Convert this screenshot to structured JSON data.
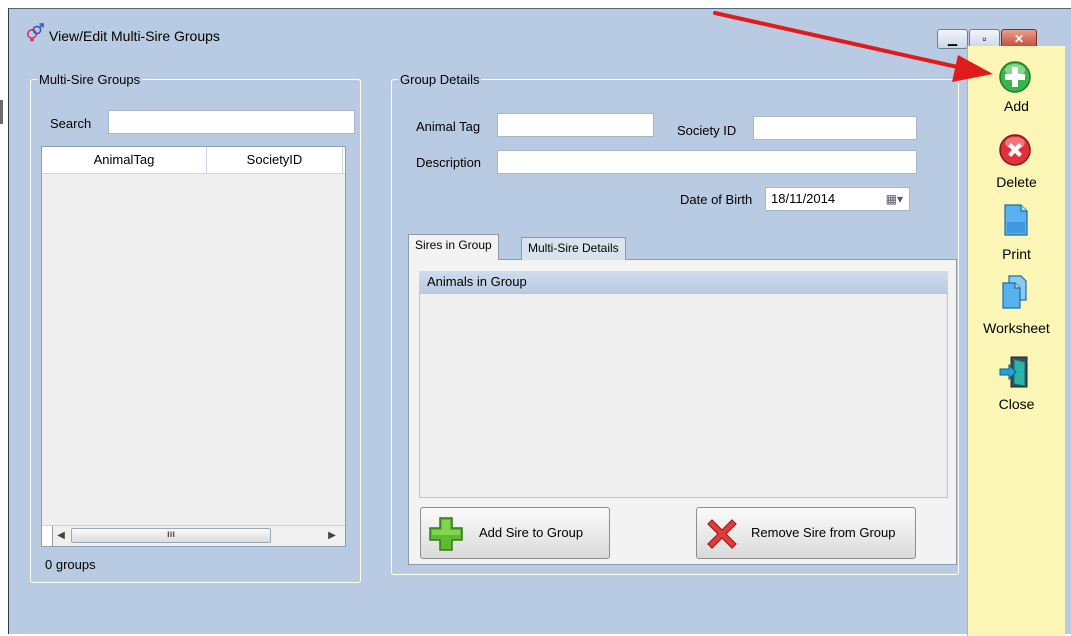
{
  "window": {
    "title": "View/Edit Multi-Sire Groups"
  },
  "left_group": {
    "legend": "Multi-Sire Groups",
    "search_label": "Search",
    "search_value": "",
    "columns": [
      "AnimalTag",
      "SocietyID"
    ],
    "rows": [],
    "status": "0 groups"
  },
  "right_group": {
    "legend": "Group Details",
    "animal_tag_label": "Animal Tag",
    "animal_tag_value": "",
    "society_id_label": "Society ID",
    "society_id_value": "",
    "description_label": "Description",
    "description_value": "",
    "dob_label": "Date of Birth",
    "dob_value": "18/11/2014"
  },
  "tabs": [
    {
      "label": "Sires in Group",
      "active": true
    },
    {
      "label": "Multi-Sire Details",
      "active": false
    }
  ],
  "animals_panel": {
    "header": "Animals in Group",
    "add_button": "Add Sire to Group",
    "remove_button": "Remove Sire from Group"
  },
  "sidebar": {
    "items": [
      {
        "label": "Add",
        "icon": "add-icon"
      },
      {
        "label": "Delete",
        "icon": "delete-icon"
      },
      {
        "label": "Print",
        "icon": "print-icon"
      },
      {
        "label": "Worksheet",
        "icon": "worksheet-icon"
      },
      {
        "label": "Close",
        "icon": "close-door-icon"
      }
    ]
  },
  "colors": {
    "window_bg": "#b9cbe2",
    "sidebar_bg": "#fbf6b6",
    "annotation_arrow": "#e01b1b"
  }
}
